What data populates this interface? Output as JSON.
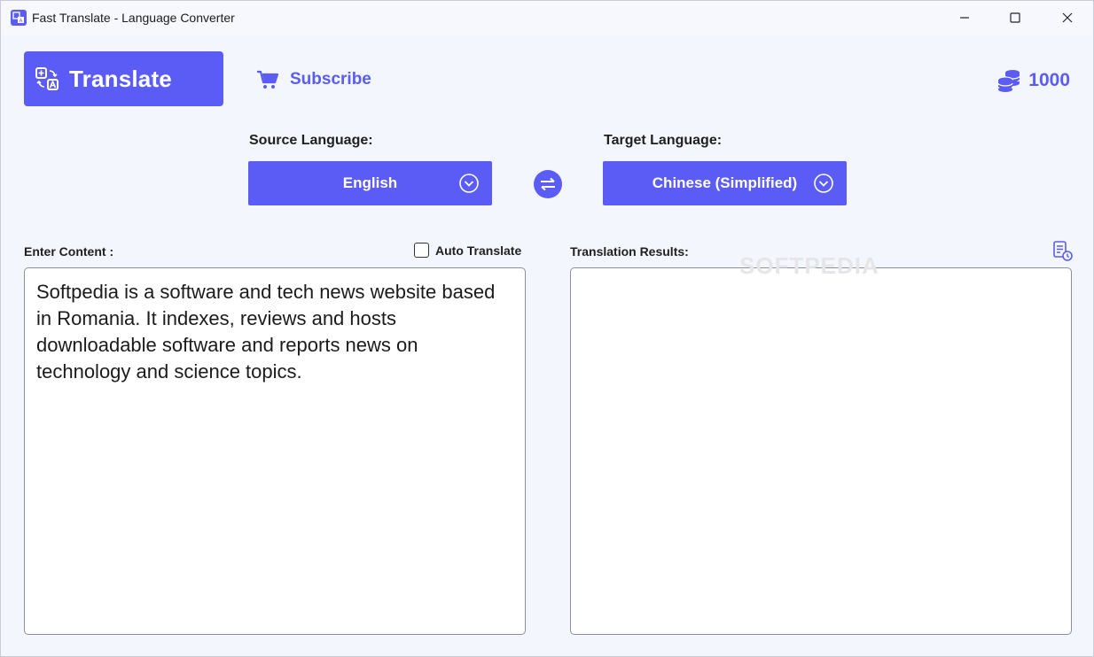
{
  "window": {
    "title": "Fast Translate - Language Converter",
    "accent_color": "#5a5cf5"
  },
  "nav": {
    "translate_label": "Translate",
    "subscribe_label": "Subscribe",
    "coins_count": "1000"
  },
  "languages": {
    "source_label": "Source Language:",
    "source_value": "English",
    "target_label": "Target Language:",
    "target_value": "Chinese (Simplified)"
  },
  "content": {
    "enter_label": "Enter Content :",
    "auto_translate_label": "Auto Translate",
    "auto_translate_checked": false,
    "input_text": "Softpedia is a software and tech news website based in Romania. It indexes, reviews and hosts downloadable software and reports news on technology and science topics.",
    "results_label": "Translation Results:",
    "results_text": ""
  },
  "watermark": "SOFTPEDIA"
}
